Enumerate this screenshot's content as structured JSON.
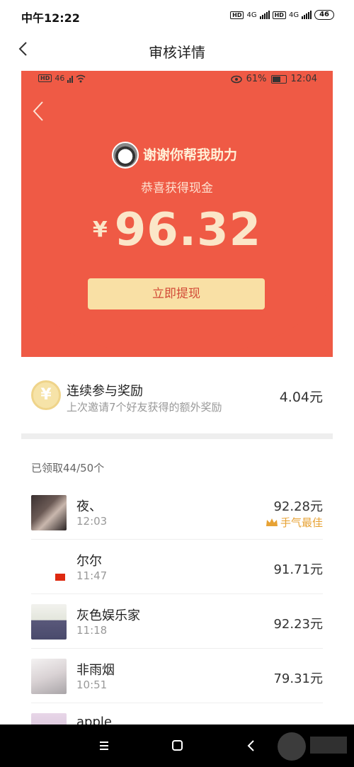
{
  "status_bar": {
    "time": "中午12:22",
    "network_1": "HD",
    "network_2": "HD",
    "signal_label": "4G",
    "battery": "46"
  },
  "header": {
    "title": "审核详情"
  },
  "red_packet": {
    "inner_status": {
      "hd": "HD",
      "signal": "46",
      "battery_percent": "61%",
      "time": "12:04"
    },
    "message": "谢谢你帮我助力",
    "congrats": "恭喜获得现金",
    "currency": "¥",
    "amount": "96.32",
    "withdraw_label": "立即提现"
  },
  "bonus": {
    "icon_text": "¥",
    "title": "连续参与奖励",
    "subtitle": "上次邀请7个好友获得的额外奖励",
    "amount": "4.04元"
  },
  "records": {
    "summary": "已领取44/50个",
    "items": [
      {
        "name": "夜、",
        "time": "12:03",
        "amount": "92.28元",
        "badge": "手气最佳"
      },
      {
        "name": "尔尔",
        "time": "11:47",
        "amount": "91.71元"
      },
      {
        "name": "灰色娱乐家",
        "time": "11:18",
        "amount": "92.23元"
      },
      {
        "name": "非雨烟",
        "time": "10:51",
        "amount": "79.31元"
      },
      {
        "name": "apple",
        "time": "",
        "amount": ""
      }
    ]
  },
  "nav": {
    "menu_icon": "menu-icon",
    "home_icon": "home-icon",
    "back_icon": "back-icon"
  },
  "colors": {
    "accent_red": "#ef5a45",
    "gold": "#f9e0a5",
    "best_badge": "#e7a234"
  }
}
